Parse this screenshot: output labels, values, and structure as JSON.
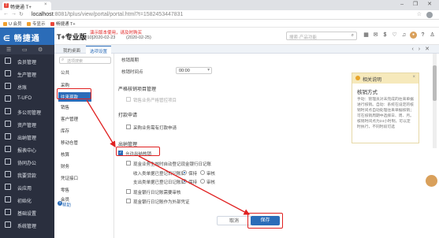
{
  "browser": {
    "tab_title": "畅捷通 T+",
    "tab_close": "×",
    "win_controls": "– ❐ ✕",
    "url_host": "localhost",
    "url_path": ":8081/tplus/view/portal/portal.html?t=1582453447831",
    "bookmarks": [
      "U 会员",
      "专显示",
      "畅捷通 T+"
    ]
  },
  "header": {
    "logo": "畅捷通",
    "product": "T+专业版",
    "demo_note": "演示版本使用，请及时购买",
    "demo_date1": "[010]2020-02-23",
    "demo_date2": "(2020-02-25)",
    "search_placeholder": "搜索·产品功能"
  },
  "leftnav": {
    "items": [
      "会员管理",
      "生产管理",
      "总账",
      "T-UFO",
      "多公司管理",
      "资产管理",
      "出纳管理",
      "报表中心",
      "协同办公",
      "我要贷款",
      "云应用",
      "初始化",
      "基础设置",
      "系统管理"
    ]
  },
  "tabs": [
    "我的桌面",
    "选项设置"
  ],
  "subnav": {
    "search_placeholder": "选项搜索",
    "items": [
      "公共",
      "采购",
      "往来现款",
      "销售",
      "客户管理",
      "库存",
      "移动仓管",
      "核算",
      "财务",
      "凭证接口",
      "零售",
      "会员"
    ],
    "active_index": 2,
    "help": "帮助"
  },
  "content": {
    "rows": {
      "period_label": "核销周期",
      "time_label": "核销时间点",
      "time_value": "00:00",
      "sec_strict": "严格核销项目管理",
      "strict_opt": "销售业务严格管控项目",
      "sec_apply": "打款申请",
      "apply_opt": "采购业务需有打款申请",
      "sec_cashier": "出纳管理",
      "auto_cashier": "允许出纳核销",
      "auto_opt1": "现金业务生效时自动登记现金银行日记账",
      "income_label": "收入类单据已登记日记账后",
      "opt_keep": "保持",
      "opt_audit": "审核",
      "expense_label": "支出类单据已登记日记账后",
      "cash_opt": "现金银行日记账需要审核",
      "cash_opt2": "现金银行日记账作为外部凭证"
    }
  },
  "help_panel": {
    "title": "相关说明",
    "subtitle": "核销方式",
    "body": "手动：管理员对未完成的往来单据进行核销。自动：系统在设定的核销时间点自动处理往来单据核销；可在核销周期中选择日、周、月。核销时间点为24小时制，可以定时执行，不同时段可选"
  },
  "buttons": {
    "cancel": "取消",
    "save": "保存"
  },
  "colors": {
    "brand_blue": "#2b6cb8",
    "highlight_red": "#e02020",
    "nav_bg": "#2a2f3e"
  }
}
